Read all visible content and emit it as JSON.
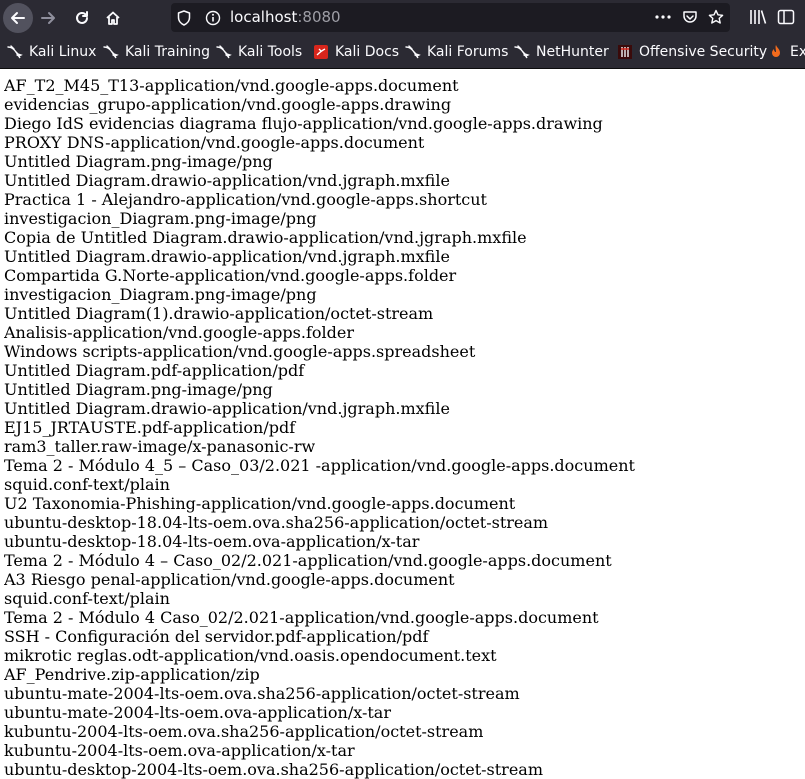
{
  "browser": {
    "url_host": "localhost",
    "url_port": ":8080"
  },
  "bookmarks": [
    {
      "label": "Kali Linux",
      "icon": "kali-dragon-icon"
    },
    {
      "label": "Kali Training",
      "icon": "kali-dragon-icon"
    },
    {
      "label": "Kali Tools",
      "icon": "kali-dragon-icon"
    },
    {
      "label": "Kali Docs",
      "icon": "kali-docs-icon"
    },
    {
      "label": "Kali Forums",
      "icon": "kali-dragon-icon"
    },
    {
      "label": "NetHunter",
      "icon": "kali-dragon-icon"
    },
    {
      "label": "Offensive Security",
      "icon": "offsec-icon"
    },
    {
      "label": "Ex",
      "icon": "exploit-db-icon"
    }
  ],
  "files": [
    "AF_T2_M45_T13-application/vnd.google-apps.document",
    "evidencias_grupo-application/vnd.google-apps.drawing",
    "Diego IdS evidencias diagrama flujo-application/vnd.google-apps.drawing",
    "PROXY DNS-application/vnd.google-apps.document",
    "Untitled Diagram.png-image/png",
    "Untitled Diagram.drawio-application/vnd.jgraph.mxfile",
    "Practica 1 - Alejandro-application/vnd.google-apps.shortcut",
    "investigacion_Diagram.png-image/png",
    "Copia de Untitled Diagram.drawio-application/vnd.jgraph.mxfile",
    "Untitled Diagram.drawio-application/vnd.jgraph.mxfile",
    "Compartida G.Norte-application/vnd.google-apps.folder",
    "investigacion_Diagram.png-image/png",
    "Untitled Diagram(1).drawio-application/octet-stream",
    "Analisis-application/vnd.google-apps.folder",
    "Windows scripts-application/vnd.google-apps.spreadsheet",
    "Untitled Diagram.pdf-application/pdf",
    "Untitled Diagram.png-image/png",
    "Untitled Diagram.drawio-application/vnd.jgraph.mxfile",
    "EJ15_JRTAUSTE.pdf-application/pdf",
    "ram3_taller.raw-image/x-panasonic-rw",
    "Tema 2 - Módulo 4_5 – Caso_03/2.021 -application/vnd.google-apps.document",
    "squid.conf-text/plain",
    "U2 Taxonomia-Phishing-application/vnd.google-apps.document",
    "ubuntu-desktop-18.04-lts-oem.ova.sha256-application/octet-stream",
    "ubuntu-desktop-18.04-lts-oem.ova-application/x-tar",
    "Tema 2 - Módulo 4 – Caso_02/2.021-application/vnd.google-apps.document",
    "A3 Riesgo penal-application/vnd.google-apps.document",
    "squid.conf-text/plain",
    "Tema 2 - Módulo 4 Caso_02/2.021-application/vnd.google-apps.document",
    "SSH - Configuración del servidor.pdf-application/pdf",
    "mikrotic reglas.odt-application/vnd.oasis.opendocument.text",
    "AF_Pendrive.zip-application/zip",
    "ubuntu-mate-2004-lts-oem.ova.sha256-application/octet-stream",
    "ubuntu-mate-2004-lts-oem.ova-application/x-tar",
    "kubuntu-2004-lts-oem.ova.sha256-application/octet-stream",
    "kubuntu-2004-lts-oem.ova-application/x-tar",
    "ubuntu-desktop-2004-lts-oem.ova.sha256-application/octet-stream"
  ]
}
